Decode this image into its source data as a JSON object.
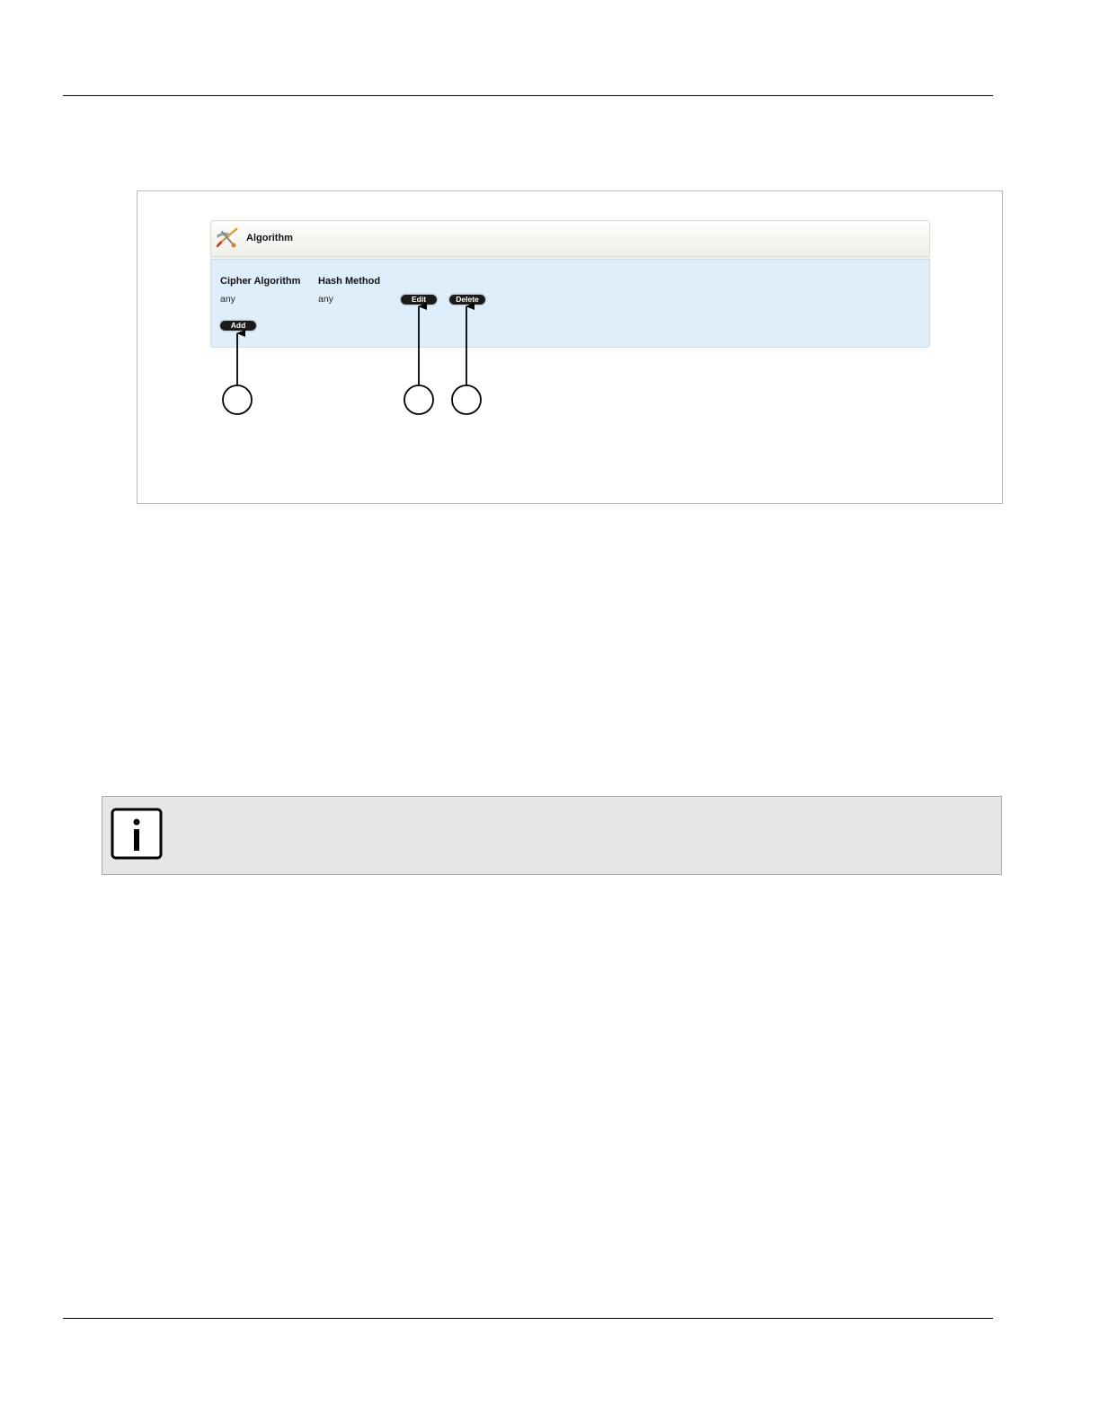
{
  "figure": {
    "panel": {
      "title": "Algorithm",
      "icon": "algorithm-tools-icon",
      "columns": [
        "Cipher Algorithm",
        "Hash Method"
      ],
      "rows": [
        {
          "cipher_algorithm": "any",
          "hash_method": "any"
        }
      ],
      "buttons": {
        "edit": "Edit",
        "delete": "Delete",
        "add": "Add"
      },
      "colors": {
        "header_bg": "#f6f5f1",
        "body_bg": "#dfeefb",
        "button_bg": "#1a1a1a"
      }
    },
    "callouts": [
      {
        "target": "add-button",
        "label": ""
      },
      {
        "target": "edit-button",
        "label": ""
      },
      {
        "target": "delete-button",
        "label": ""
      }
    ]
  },
  "note": {
    "icon": "info-icon",
    "colors": {
      "bg": "#e6e6e6",
      "border": "#a9a9a9"
    }
  }
}
